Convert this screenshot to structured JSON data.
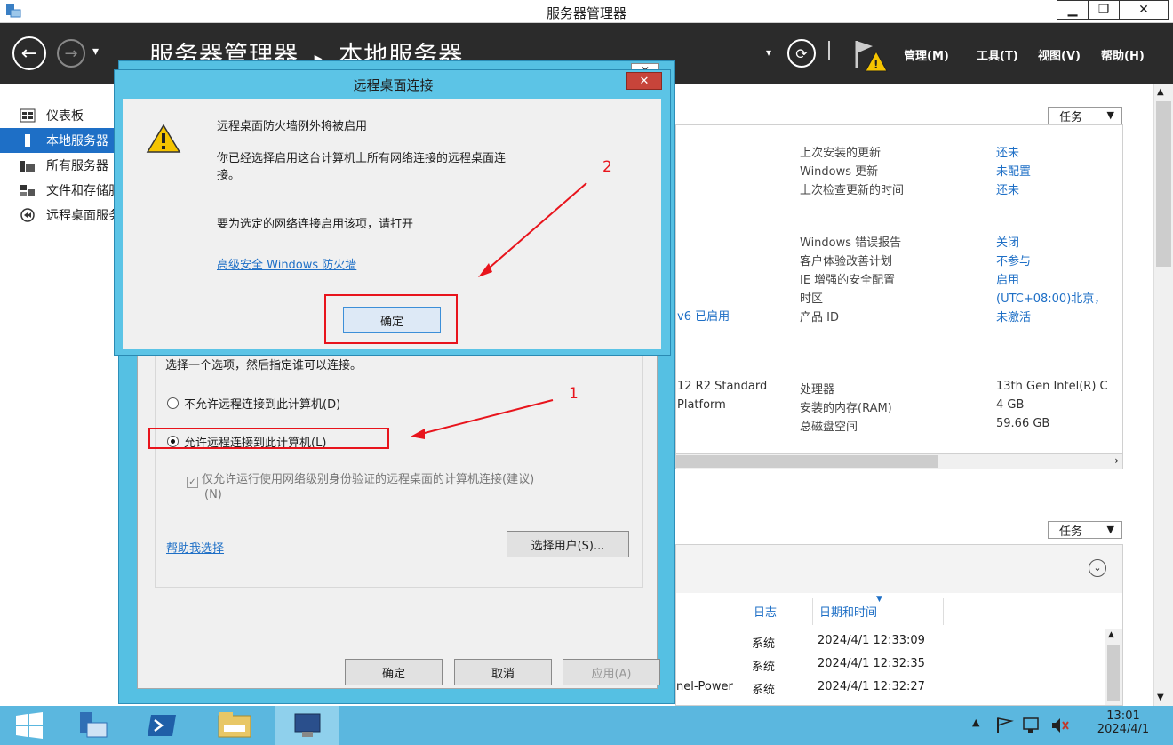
{
  "window": {
    "title": "服务器管理器",
    "minimize": "▁",
    "restore": "❐",
    "close": "✕"
  },
  "header": {
    "breadcrumb_root": "服务器管理器",
    "breadcrumb_sep": "▸",
    "breadcrumb_current": "本地服务器",
    "menus": [
      "管理(M)",
      "工具(T)",
      "视图(V)",
      "帮助(H)"
    ]
  },
  "sidebar": {
    "items": [
      {
        "label": "仪表板"
      },
      {
        "label": "本地服务器"
      },
      {
        "label": "所有服务器"
      },
      {
        "label": "文件和存储服务"
      },
      {
        "label": "远程桌面服务"
      }
    ]
  },
  "panel": {
    "tasks_label": "任务",
    "left_fragments": [
      "v6 已启用",
      "12 R2 Standard",
      "Platform",
      "nel-Power"
    ],
    "properties": [
      {
        "label": "上次安装的更新",
        "value": "还未"
      },
      {
        "label": "Windows 更新",
        "value": "未配置"
      },
      {
        "label": "上次检查更新的时间",
        "value": "还未"
      },
      {
        "label": "Windows 错误报告",
        "value": "关闭"
      },
      {
        "label": "客户体验改善计划",
        "value": "不参与"
      },
      {
        "label": "IE 增强的安全配置",
        "value": "启用"
      },
      {
        "label": "时区",
        "value": "(UTC+08:00)北京，"
      },
      {
        "label": "产品 ID",
        "value": "未激活"
      },
      {
        "label": "处理器",
        "value": "13th Gen Intel(R) C"
      },
      {
        "label": "安装的内存(RAM)",
        "value": "4 GB"
      },
      {
        "label": "总磁盘空间",
        "value": "59.66 GB"
      }
    ]
  },
  "events": {
    "tasks_label": "任务",
    "col_log": "日志",
    "col_datetime": "日期和时间",
    "rows": [
      {
        "log": "系统",
        "time": "2024/4/1 12:33:09"
      },
      {
        "log": "系统",
        "time": "2024/4/1 12:32:35"
      },
      {
        "log": "系统",
        "time": "2024/4/1 12:32:27"
      }
    ]
  },
  "back_dialog": {
    "instruction": "选择一个选项，然后指定谁可以连接。",
    "option_disallow": "不允许远程连接到此计算机(D)",
    "option_allow": "允许远程连接到此计算机(L)",
    "nla_checkbox": "仅允许运行使用网络级别身份验证的远程桌面的计算机连接(建议)",
    "nla_shortcut": "(N)",
    "help_link": "帮助我选择",
    "select_users": "选择用户(S)...",
    "ok": "确定",
    "cancel": "取消",
    "apply": "应用(A)"
  },
  "front_dialog": {
    "title": "远程桌面连接",
    "line1": "远程桌面防火墙例外将被启用",
    "line2": "你已经选择启用这台计算机上所有网络连接的远程桌面连",
    "line2b": "接。",
    "line3": "要为选定的网络连接启用该项，请打开",
    "link": "高级安全 Windows 防火墙",
    "ok": "确定",
    "close": "✕"
  },
  "annotations": {
    "label1": "1",
    "label2": "2"
  },
  "taskbar": {
    "time": "13:01",
    "date": "2024/4/1"
  },
  "colors": {
    "accent": "#1e6fc6",
    "dialog_border": "#5cc4e6",
    "annotation": "#e8141c"
  }
}
